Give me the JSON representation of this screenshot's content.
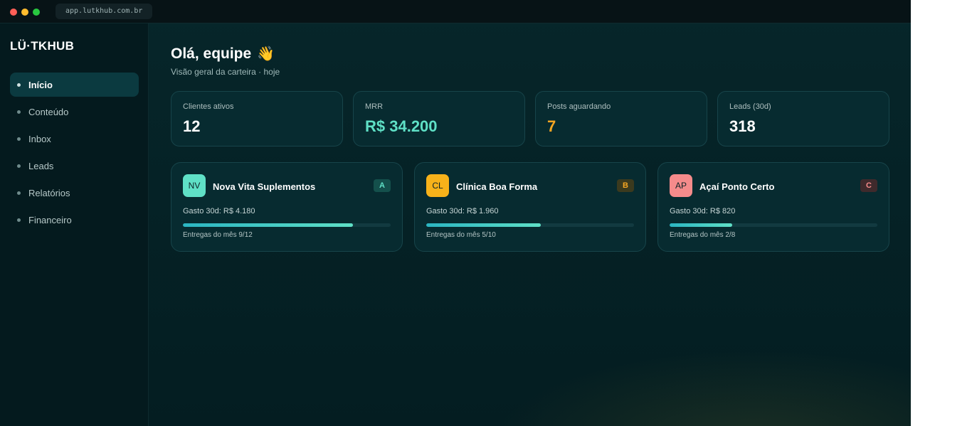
{
  "browser": {
    "url": "app.lutkhub.com.br"
  },
  "sidebar": {
    "logo": "LÜ·TKHUB",
    "items": [
      {
        "label": "Início",
        "active": true
      },
      {
        "label": "Conteúdo",
        "active": false
      },
      {
        "label": "Inbox",
        "active": false
      },
      {
        "label": "Leads",
        "active": false
      },
      {
        "label": "Relatórios",
        "active": false
      },
      {
        "label": "Financeiro",
        "active": false
      }
    ]
  },
  "header": {
    "title": "Olá, equipe",
    "wave_emoji": "👋",
    "subtitle": "Visão geral da carteira · hoje"
  },
  "stats": [
    {
      "label": "Clientes ativos",
      "value": "12",
      "color": "#ffffff"
    },
    {
      "label": "MRR",
      "value": "R$ 34.200",
      "color": "#5fe0c6"
    },
    {
      "label": "Posts aguardando",
      "value": "7",
      "color": "#f5a623"
    },
    {
      "label": "Leads (30d)",
      "value": "318",
      "color": "#ffffff"
    }
  ],
  "clients": [
    {
      "initials": "NV",
      "name": "Nova Vita Suplementos",
      "tier": "A",
      "spend": "Gasto 30d: R$ 4.180",
      "deliveries": "Entregas do mês 9/12",
      "progress": 0.82,
      "avatar_color": "#5fe0c6",
      "tier_bg": "#14504c",
      "tier_color": "#5fe0c6"
    },
    {
      "initials": "CL",
      "name": "Clínica Boa Forma",
      "tier": "B",
      "spend": "Gasto 30d: R$ 1.960",
      "deliveries": "Entregas do mês 5/10",
      "progress": 0.55,
      "avatar_color": "#f7b21a",
      "tier_bg": "#3b3a1e",
      "tier_color": "#f5a623"
    },
    {
      "initials": "AP",
      "name": "Açaí Ponto Certo",
      "tier": "C",
      "spend": "Gasto 30d: R$ 820",
      "deliveries": "Entregas do mês 2/8",
      "progress": 0.3,
      "avatar_color": "#f58b8b",
      "tier_bg": "#3f2a2c",
      "tier_color": "#f58b8b"
    }
  ]
}
